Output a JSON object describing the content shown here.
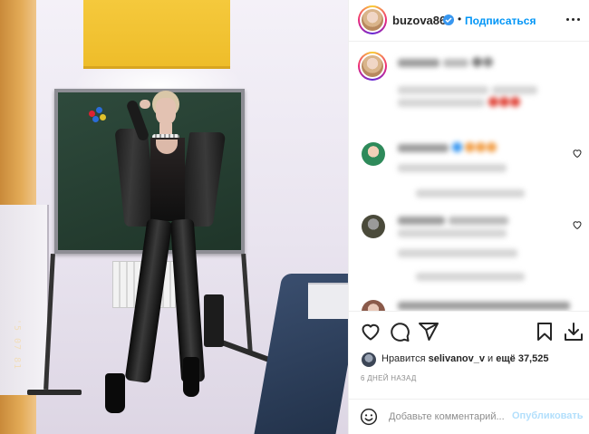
{
  "post": {
    "date_stamp": "'5 07 81"
  },
  "header": {
    "username": "buzova86",
    "separator": "•",
    "follow_label": "Подписаться"
  },
  "actions": {
    "like_icon": "heart-icon",
    "comment_icon": "comment-icon",
    "share_icon": "paper-plane-icon",
    "save_icon": "bookmark-icon",
    "download_icon": "download-icon"
  },
  "likes": {
    "prefix": "Нравится ",
    "user": "selivanov_v",
    "middle": " и ",
    "count": "ещё 37,525"
  },
  "timestamp": "6 ДНЕЙ НАЗАД",
  "comment_box": {
    "placeholder": "Добавьте комментарий...",
    "publish_label": "Опубликовать"
  },
  "colors": {
    "accent": "#0095f6",
    "publish_disabled": "#b2dffc",
    "verified": "#3897f0"
  }
}
